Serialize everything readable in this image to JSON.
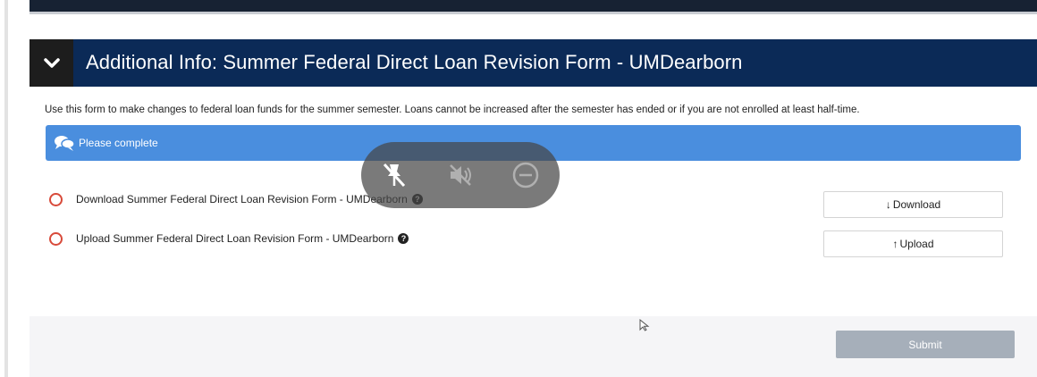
{
  "panel": {
    "title": "Additional Info: Summer Federal Direct Loan Revision Form - UMDearborn",
    "intro": "Use this form to make changes to federal loan funds for the summer semester. Loans cannot be increased after the semester has ended or if you are not enrolled at least half-time."
  },
  "alert": {
    "text": "Please complete",
    "icon": "chat-bubbles-icon"
  },
  "tasks": [
    {
      "label": "Download Summer Federal Direct Loan Revision Form - UMDearborn",
      "button_label": "Download",
      "button_icon": "arrow-down-icon"
    },
    {
      "label": "Upload Summer Federal Direct Loan Revision Form - UMDearborn",
      "button_label": "Upload",
      "button_icon": "arrow-up-icon"
    }
  ],
  "footer": {
    "submit_label": "Submit"
  },
  "overlay": {
    "icons": [
      "pin-off-icon",
      "speaker-muted-icon",
      "minus-circle-icon"
    ]
  },
  "colors": {
    "header": "#0b2a57",
    "alert": "#4a8ede",
    "radio": "#d84a3a",
    "submit_disabled": "#a6afba"
  }
}
